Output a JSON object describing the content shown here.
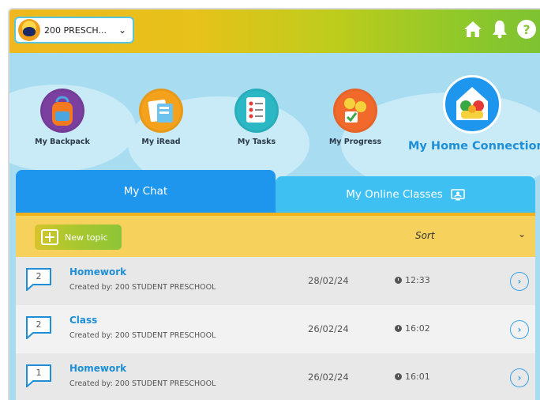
{
  "topbar": {
    "school_name": "200 PRESCH...",
    "icons": [
      "home-icon",
      "bell-icon",
      "help-icon"
    ]
  },
  "nav": {
    "items": [
      {
        "label": "My Backpack",
        "icon": "backpack-icon",
        "color": "#7b3fa0"
      },
      {
        "label": "My iRead",
        "icon": "reader-icon",
        "color": "#f4a21c"
      },
      {
        "label": "My Tasks",
        "icon": "tasks-icon",
        "color": "#2bb8c4"
      },
      {
        "label": "My Progress",
        "icon": "progress-icon",
        "color": "#f26a2b"
      },
      {
        "label": "My Home Connection",
        "icon": "home-connection-icon",
        "color": "#1e96ee"
      }
    ]
  },
  "tabs": {
    "chat": "My Chat",
    "classes": "My Online Classes"
  },
  "toolbar": {
    "new_topic": "New topic",
    "sort": "Sort"
  },
  "topics": [
    {
      "count": "2",
      "title": "Homework",
      "creator": "Created by: 200 STUDENT PRESCHOOL",
      "date": "28/02/24",
      "time": "12:33"
    },
    {
      "count": "2",
      "title": "Class",
      "creator": "Created by: 200 STUDENT PRESCHOOL",
      "date": "26/02/24",
      "time": "16:02"
    },
    {
      "count": "1",
      "title": "Homework",
      "creator": "Created by: 200 STUDENT PRESCHOOL",
      "date": "26/02/24",
      "time": "16:01"
    }
  ],
  "colors": {
    "accent_blue": "#1e96ee",
    "tab_light_blue": "#3ec1f2",
    "toolbar_yellow": "#f6d15c",
    "link_blue": "#1e8fd6"
  }
}
